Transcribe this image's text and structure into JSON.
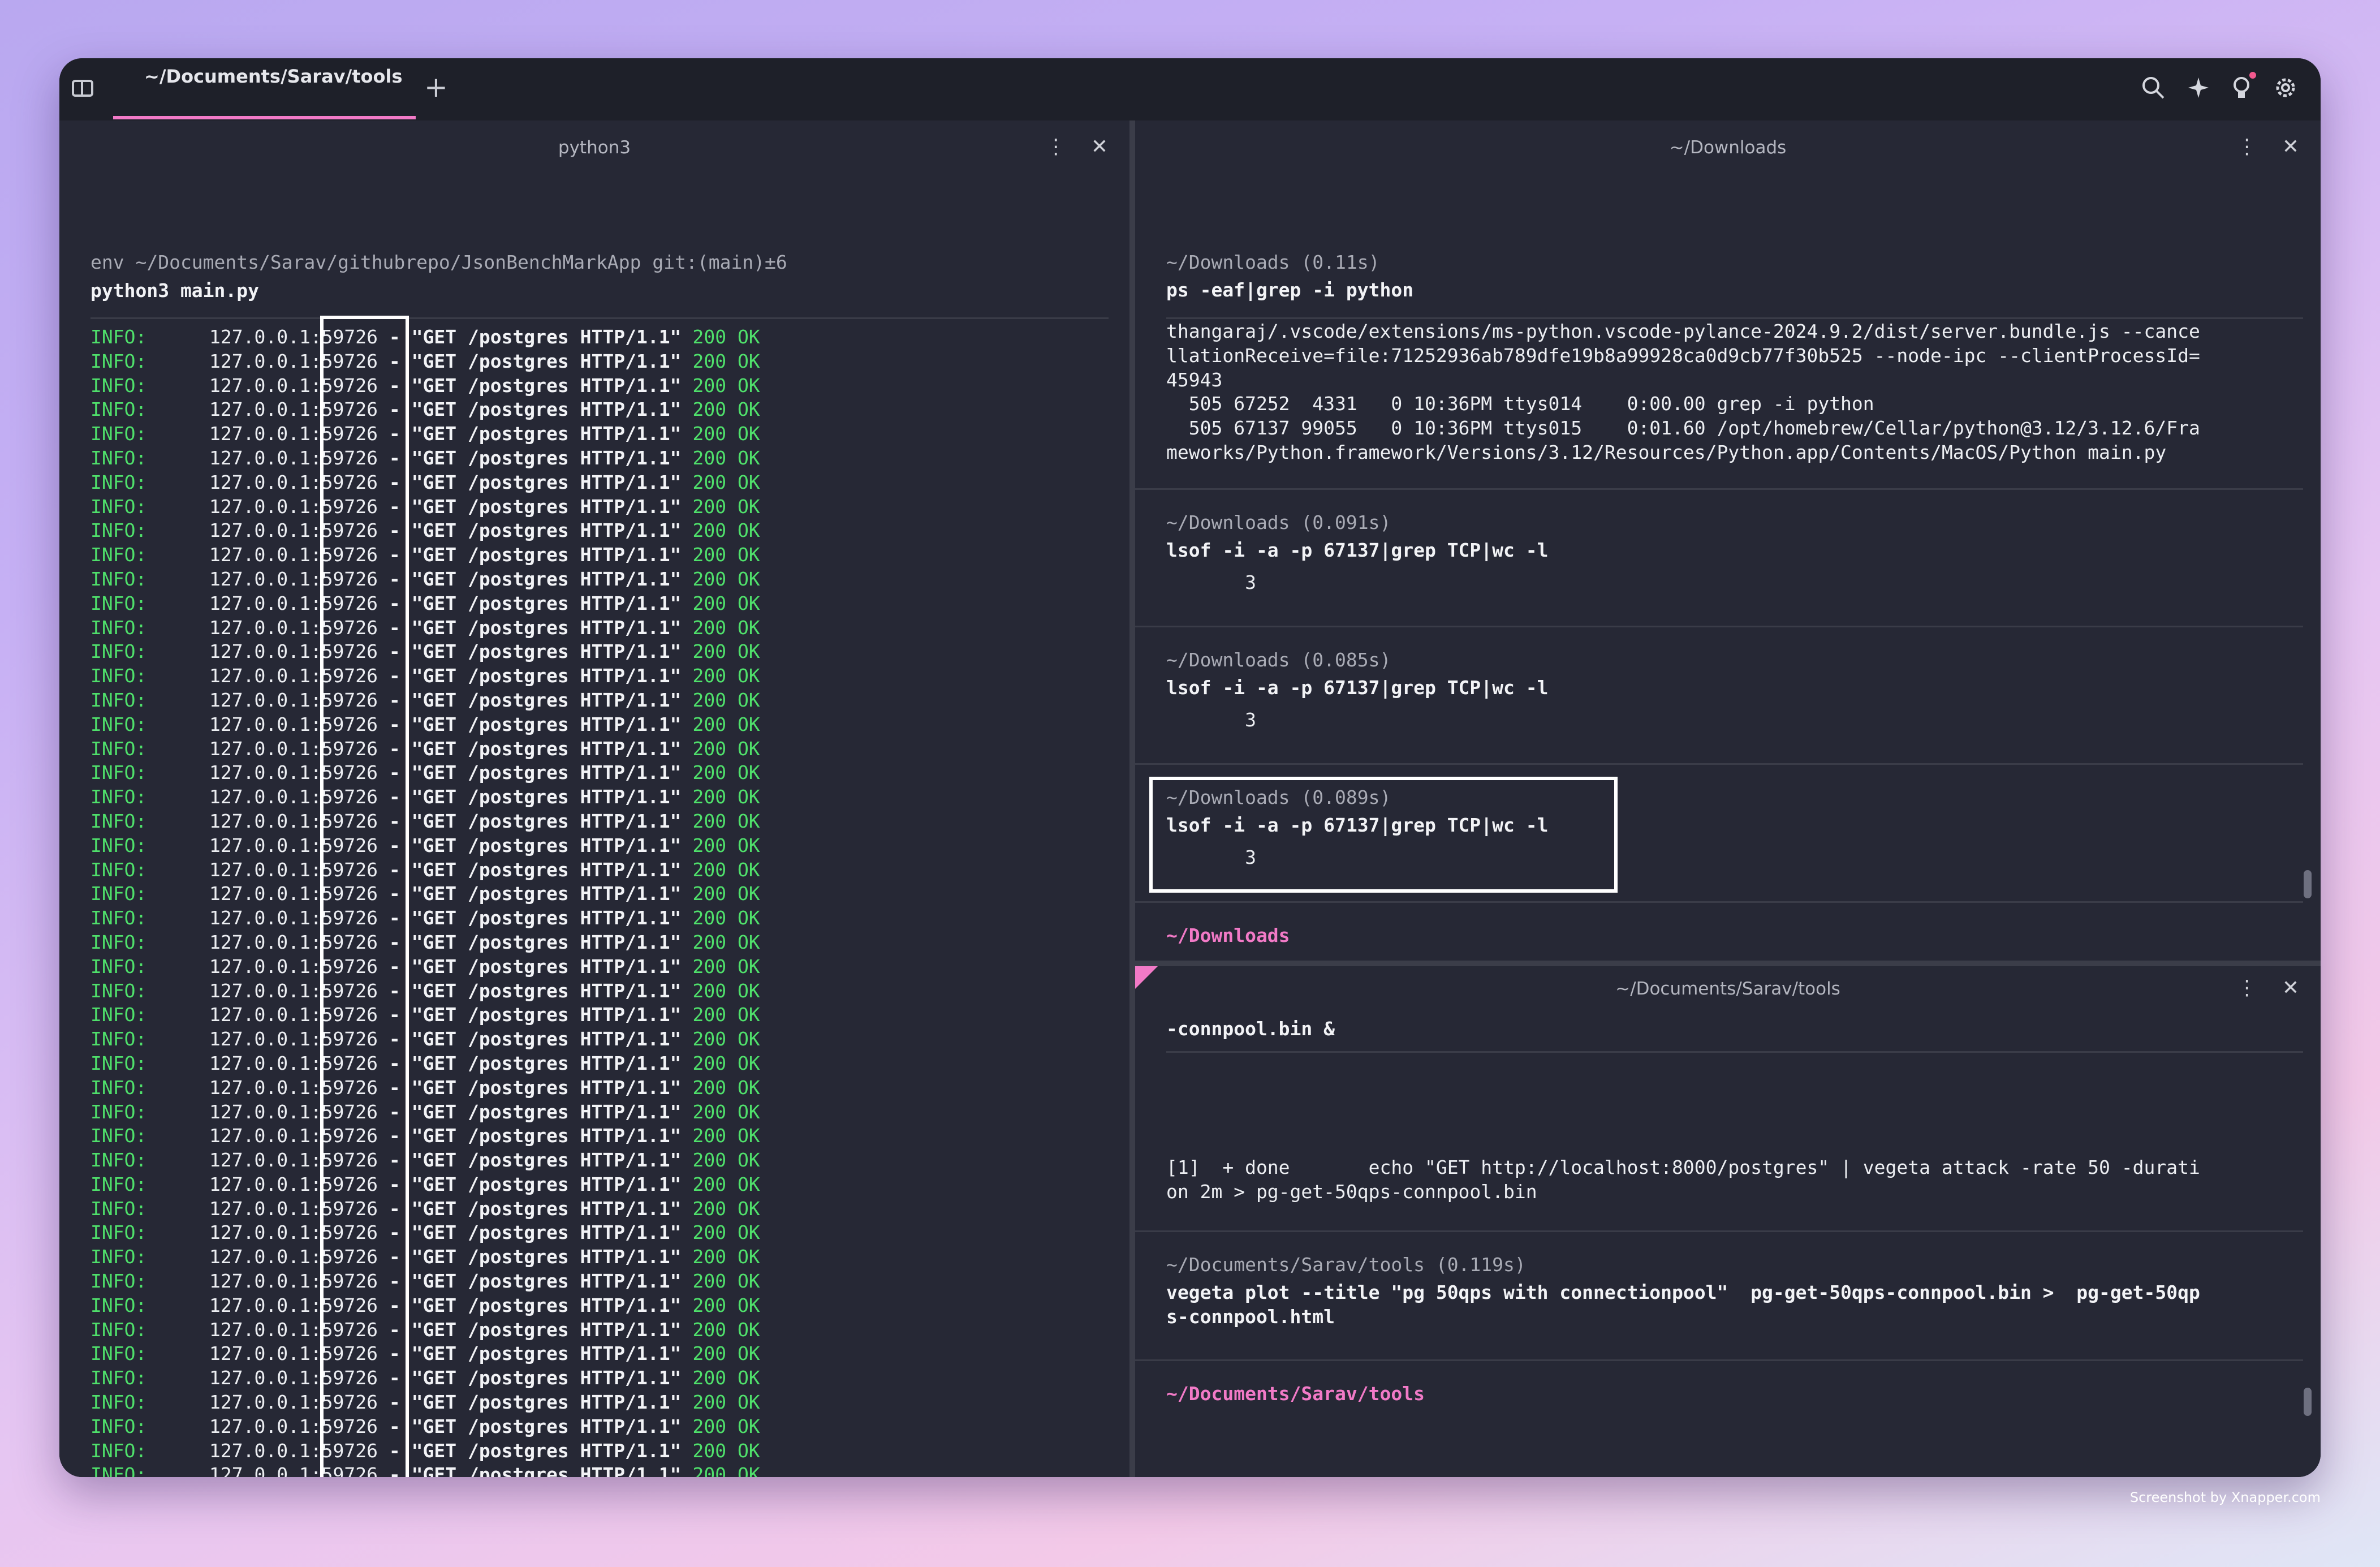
{
  "topbar": {
    "tab_label": "~/Documents/Sarav/tools",
    "new_tab": "+",
    "icons": [
      "sidebar-icon",
      "search-icon",
      "sparkle-icon",
      "lightbulb-icon",
      "gear-icon"
    ]
  },
  "left_pane": {
    "title": "python3",
    "prompt": "env ~/Documents/Sarav/githubrepo/JsonBenchMarkApp git:(main)±6",
    "command": "python3 main.py",
    "log_row": {
      "level": "INFO:",
      "addr": "127.0.0.1",
      "port": ":59726",
      "request": " - \"GET /postgres HTTP/1.1\"",
      "status": "200 OK"
    }
  },
  "right_top_pane": {
    "title": "~/Downloads",
    "blocks": [
      {
        "prompt": "~/Downloads (0.11s)",
        "command": "ps -eaf|grep -i python",
        "output": [
          "thangaraj/.vscode/extensions/ms-python.vscode-pylance-2024.9.2/dist/server.bundle.js --cance",
          "llationReceive=file:71252936ab789dfe19b8a99928ca0d9cb77f30b525 --node-ipc --clientProcessId=",
          "45943",
          "  505 67252  4331   0 10:36PM ttys014    0:00.00 grep -i python",
          "  505 67137 99055   0 10:36PM ttys015    0:01.60 /opt/homebrew/Cellar/python@3.12/3.12.6/Fra",
          "meworks/Python.framework/Versions/3.12/Resources/Python.app/Contents/MacOS/Python main.py"
        ]
      },
      {
        "prompt": "~/Downloads (0.091s)",
        "command": "lsof -i -a -p 67137|grep TCP|wc -l",
        "output": [
          "       3"
        ]
      },
      {
        "prompt": "~/Downloads (0.085s)",
        "command": "lsof -i -a -p 67137|grep TCP|wc -l",
        "output": [
          "       3"
        ]
      },
      {
        "prompt": "~/Downloads (0.089s)",
        "command": "lsof -i -a -p 67137|grep TCP|wc -l",
        "output": [
          "       3"
        ]
      }
    ],
    "active_prompt": "~/Downloads"
  },
  "right_bottom_pane": {
    "title": "~/Documents/Sarav/tools",
    "partial_line": "-connpool.bin &",
    "job_lines": [
      "[1]  + done       echo \"GET http://localhost:8000/postgres\" | vegeta attack -rate 50 -durati",
      "on 2m > pg-get-50qps-connpool.bin"
    ],
    "block": {
      "prompt": "~/Documents/Sarav/tools (0.119s)",
      "command": [
        "vegeta plot --title \"pg 50qps with connectionpool\"  pg-get-50qps-connpool.bin >  pg-get-50qp",
        "s-connpool.html"
      ]
    },
    "active_prompt": "~/Documents/Sarav/tools"
  },
  "credit": "Screenshot by Xnapper.com"
}
